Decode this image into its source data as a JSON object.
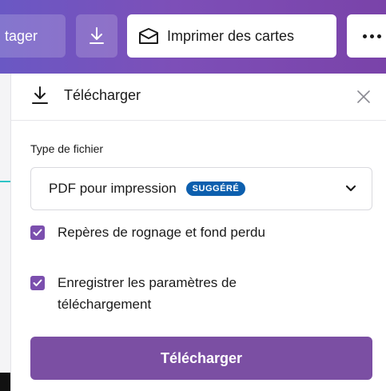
{
  "toolbar": {
    "share_label": "tager",
    "print_label": "Imprimer des cartes",
    "more_label": "•••",
    "colors": {
      "bar_start": "#6a58c4",
      "bar_end": "#7a43a9"
    },
    "icons": {
      "download": "download-icon",
      "print": "card-print-icon",
      "more": "more-dots-icon"
    }
  },
  "panel": {
    "title": "Télécharger",
    "icons": {
      "header": "download-icon",
      "close": "close-icon"
    },
    "file_type": {
      "label": "Type de fichier",
      "selected": "PDF pour impression",
      "badge": "SUGGÉRÉ",
      "badge_color": "#0d5fae",
      "chevron": "chevron-down-icon"
    },
    "options": [
      {
        "label": "Repères de rognage et fond perdu",
        "checked": true
      },
      {
        "label": "Enregistrer les paramètres de téléchargement",
        "checked": true
      }
    ],
    "download_button": "Télécharger",
    "accent_color": "#7b4fa3"
  }
}
